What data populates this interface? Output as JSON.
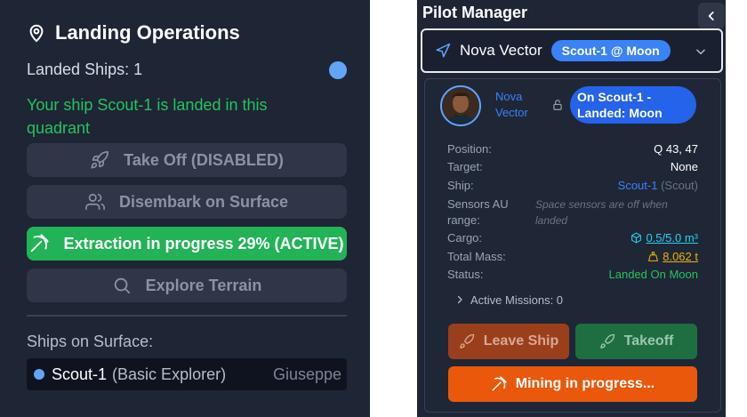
{
  "landing": {
    "title": "Landing Operations",
    "landed_ships": "Landed Ships: 1",
    "message": "Your ship Scout-1 is landed in this quadrant",
    "buttons": {
      "take_off": "Take Off (DISABLED)",
      "disembark": "Disembark on Surface",
      "extraction": "Extraction in progress 29% (ACTIVE)",
      "explore": "Explore Terrain"
    },
    "surface_label": "Ships on Surface:",
    "surface_ship": {
      "name": "Scout-1",
      "type": "(Basic Explorer)",
      "pilot": "Giuseppe"
    },
    "colors": {
      "active": "#22b356",
      "status_dot": "#60a5fa"
    }
  },
  "pilot_manager": {
    "title": "Pilot Manager",
    "selected_pilot": "Nova Vector",
    "location_pill": "Scout-1 @ Moon",
    "pilot_link": "Nova Vector",
    "status_pill": "On Scout-1 - Landed: Moon",
    "details": {
      "position_label": "Position:",
      "position": "Q 43, 47",
      "target_label": "Target:",
      "target": "None",
      "ship_label": "Ship:",
      "ship_name": "Scout-1",
      "ship_class": "(Scout)",
      "sensors_label": "Sensors AU range:",
      "sensors": "Space sensors are off when landed",
      "cargo_label": "Cargo:",
      "cargo": "0.5/5.0 m³",
      "mass_label": "Total Mass:",
      "mass": "8.062 t",
      "status_label": "Status:",
      "status": "Landed On Moon"
    },
    "missions": "Active Missions: 0",
    "buttons": {
      "leave_ship": "Leave Ship",
      "takeoff": "Takeoff",
      "mining": "Mining in progress..."
    },
    "colors": {
      "accent": "#3b82f6",
      "mining": "#ea580c",
      "leave": "#9a3f1c",
      "takeoff": "#1f6e42"
    }
  }
}
